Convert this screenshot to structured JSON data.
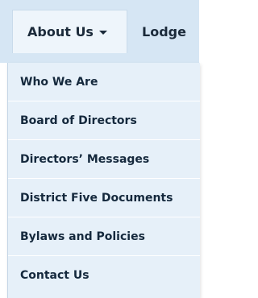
{
  "navbar": {
    "about_label": "About Us",
    "lodge_label": "Lodge"
  },
  "dropdown": {
    "items": [
      {
        "label": "Who We Are"
      },
      {
        "label": "Board of Directors"
      },
      {
        "label": "Directors’ Messages"
      },
      {
        "label": "District Five Documents"
      },
      {
        "label": "Bylaws and Policies"
      },
      {
        "label": "Contact Us"
      }
    ]
  },
  "colors": {
    "navbar_bg": "#d6e6f4",
    "active_tab_bg": "#eef5fb",
    "dropdown_bg": "#e6f0f9",
    "text": "#15293d"
  },
  "icons": {
    "caret": "caret-down-icon"
  }
}
